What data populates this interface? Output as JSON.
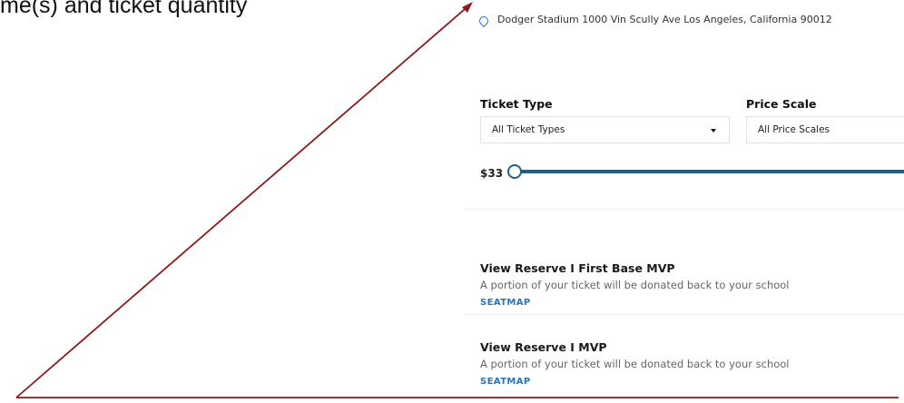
{
  "annotation": {
    "caption": "me(s) and ticket quantity",
    "arrow_color": "#8b1a1a"
  },
  "venue": {
    "icon": "location-pin-icon",
    "address": "Dodger Stadium 1000 Vin Scully Ave Los Angeles, California 90012"
  },
  "filters": {
    "ticket_type": {
      "label": "Ticket Type",
      "selected": "All Ticket Types"
    },
    "price_scale": {
      "label": "Price Scale",
      "selected": "All Price Scales"
    }
  },
  "price_slider": {
    "min_label": "$33",
    "accent_color": "#1f5e8c"
  },
  "offers": [
    {
      "title": "View Reserve I First Base MVP",
      "description": "A portion of your ticket will be donated back to your school",
      "link": "SEATMAP"
    },
    {
      "title": "View Reserve I MVP",
      "description": "A portion of your ticket will be donated back to your school",
      "link": "SEATMAP"
    }
  ]
}
